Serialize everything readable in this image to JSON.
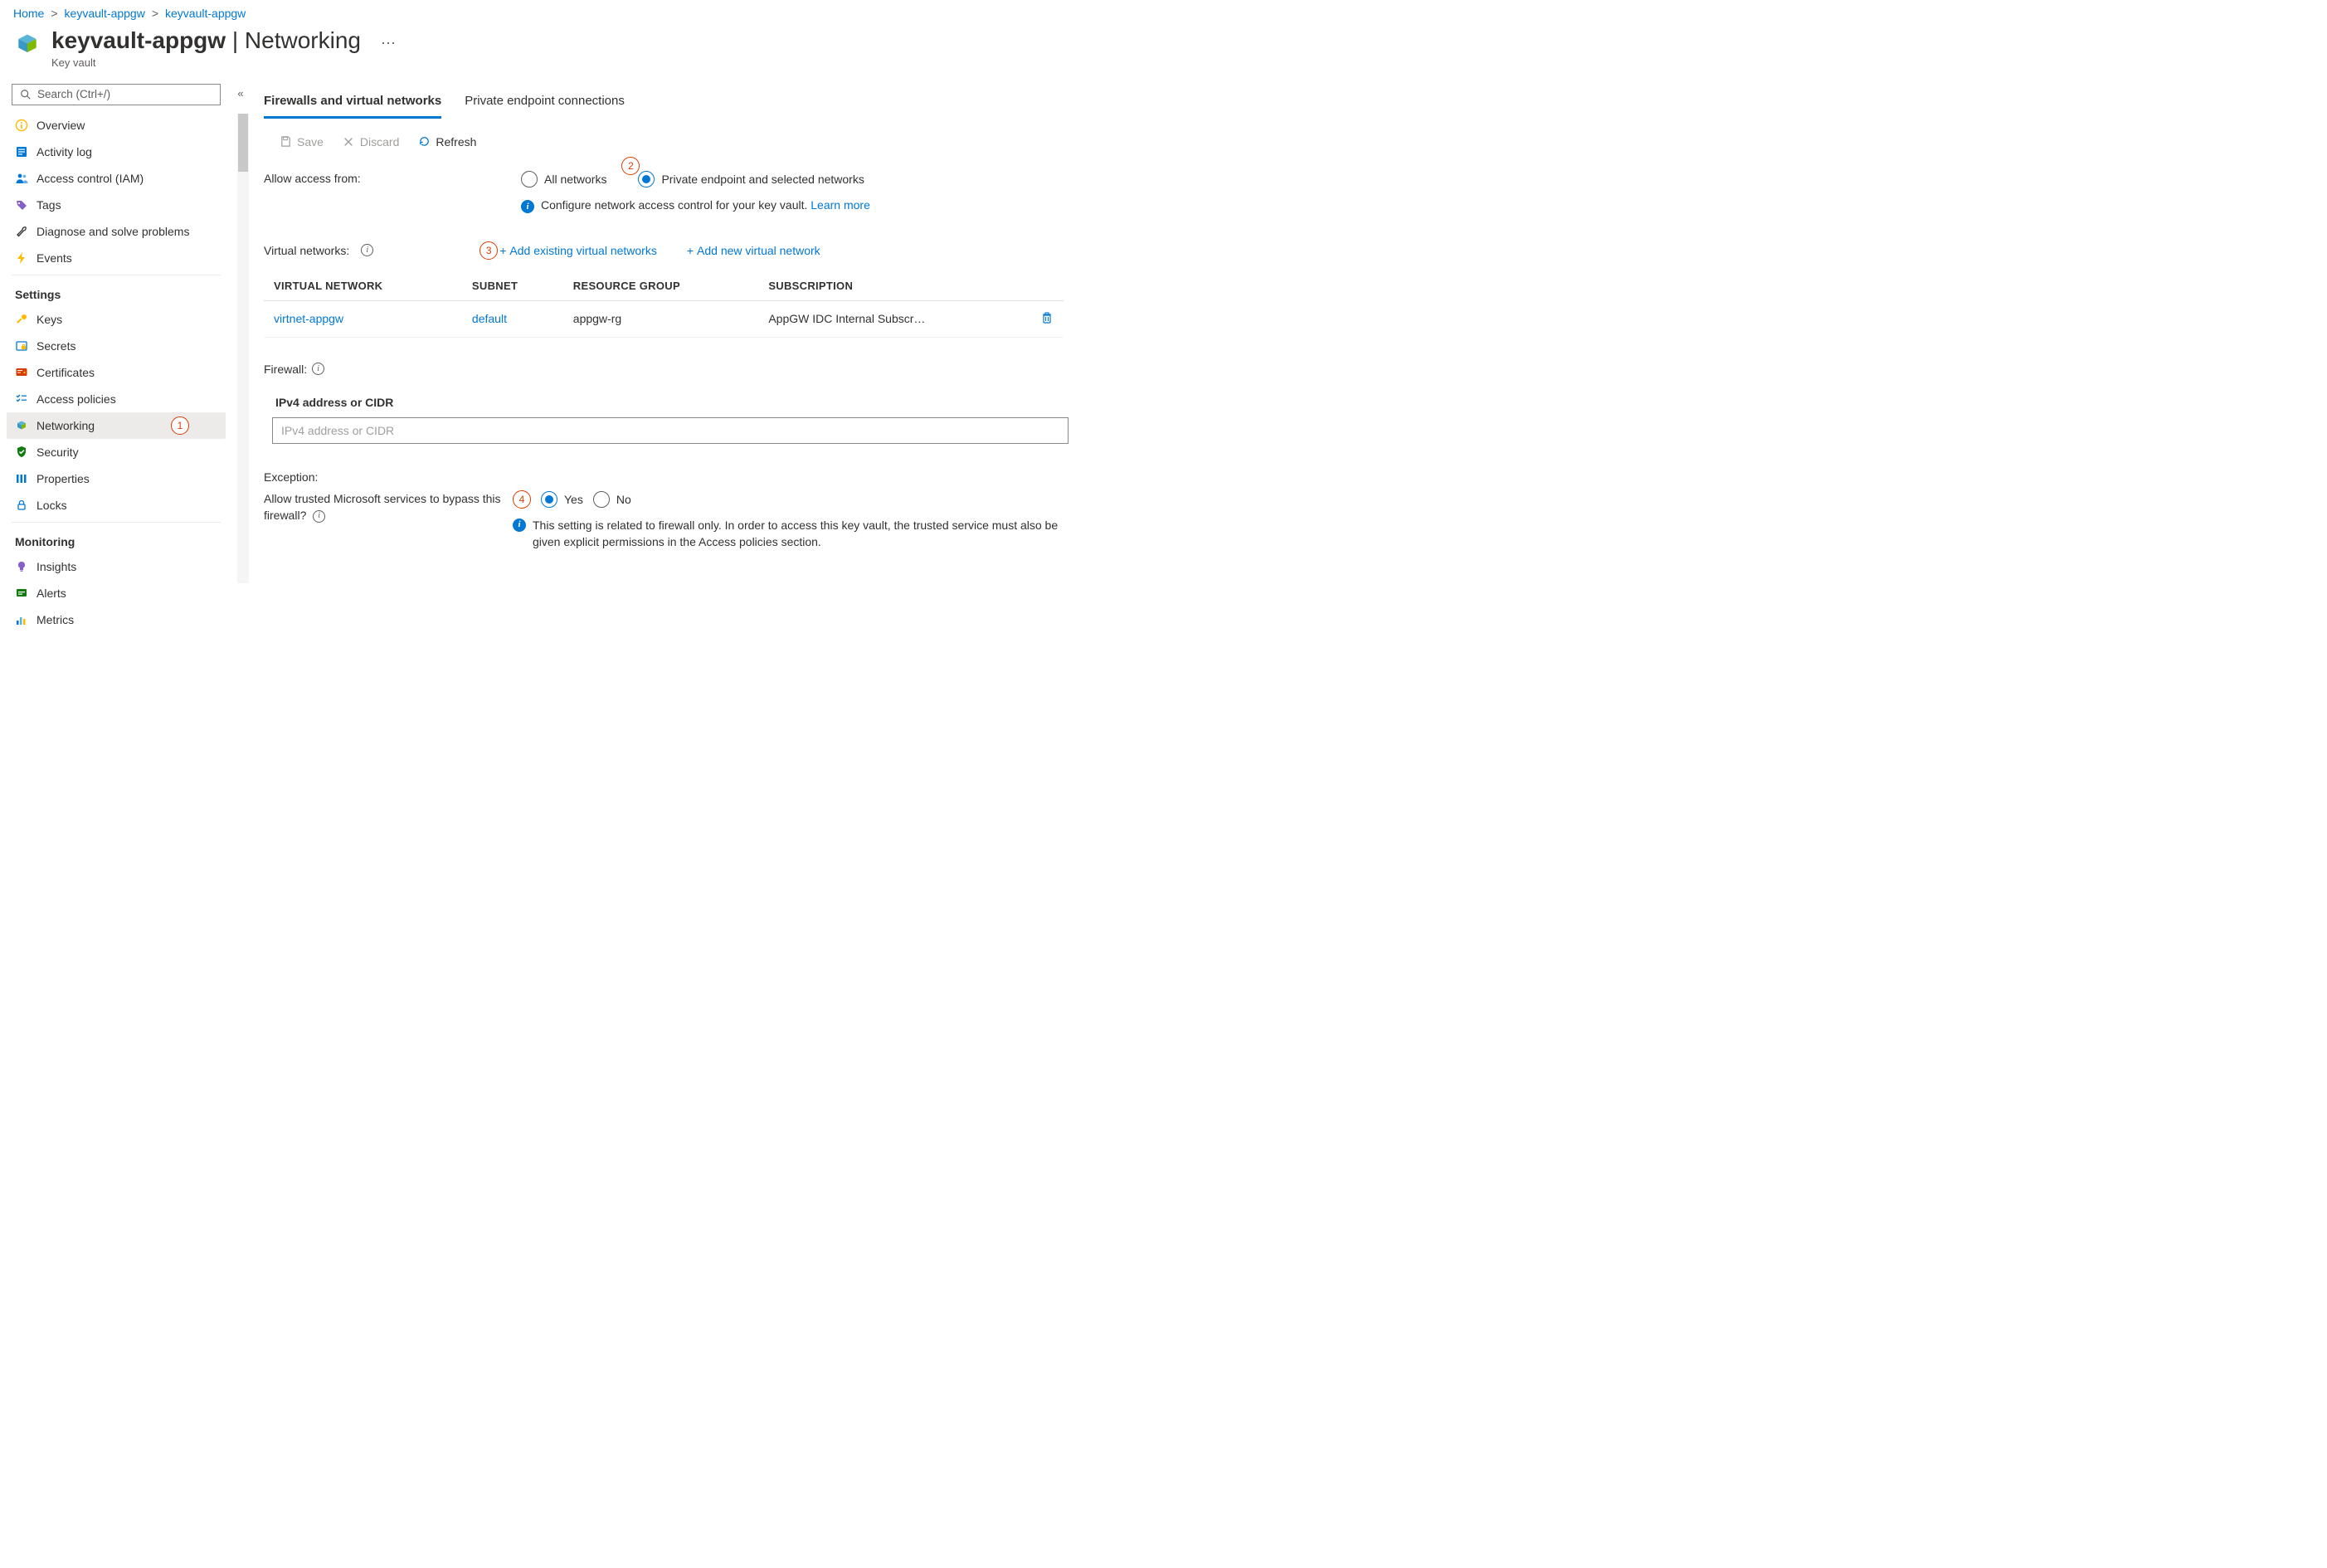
{
  "breadcrumb": {
    "home": "Home",
    "item1": "keyvault-appgw",
    "item2": "keyvault-appgw"
  },
  "header": {
    "title_main": "keyvault-appgw",
    "title_sep": " | ",
    "title_secondary": "Networking",
    "subtitle": "Key vault"
  },
  "search": {
    "placeholder": "Search (Ctrl+/)"
  },
  "nav": {
    "overview": "Overview",
    "activity": "Activity log",
    "iam": "Access control (IAM)",
    "tags": "Tags",
    "diagnose": "Diagnose and solve problems",
    "events": "Events",
    "section_settings": "Settings",
    "keys": "Keys",
    "secrets": "Secrets",
    "certs": "Certificates",
    "accesspol": "Access policies",
    "networking": "Networking",
    "security": "Security",
    "properties": "Properties",
    "locks": "Locks",
    "section_monitoring": "Monitoring",
    "insights": "Insights",
    "alerts": "Alerts",
    "metrics": "Metrics"
  },
  "annotations": {
    "a1": "1",
    "a2": "2",
    "a3": "3",
    "a4": "4"
  },
  "tabs": {
    "firewalls": "Firewalls and virtual networks",
    "private": "Private endpoint connections"
  },
  "toolbar": {
    "save": "Save",
    "discard": "Discard",
    "refresh": "Refresh"
  },
  "access": {
    "label": "Allow access from:",
    "all": "All networks",
    "selected": "Private endpoint and selected networks",
    "info_text": "Configure network access control for your key vault. ",
    "learn_more": "Learn more"
  },
  "vnets": {
    "label": "Virtual networks:",
    "add_existing": "Add existing virtual networks",
    "add_new": "Add new virtual network",
    "col_vnet": "Virtual Network",
    "col_subnet": "Subnet",
    "col_rg": "Resource Group",
    "col_sub": "Subscription",
    "row0": {
      "vnet": "virtnet-appgw",
      "subnet": "default",
      "rg": "appgw-rg",
      "subscription": "AppGW IDC Internal Subscr…"
    }
  },
  "firewall": {
    "label": "Firewall:",
    "cidr_header": "IPv4 address or CIDR",
    "cidr_placeholder": "IPv4 address or CIDR"
  },
  "exception": {
    "heading": "Exception:",
    "question": "Allow trusted Microsoft services to bypass this firewall?",
    "yes": "Yes",
    "no": "No",
    "info": "This setting is related to firewall only. In order to access this key vault, the trusted service must also be given explicit permissions in the Access policies section."
  }
}
